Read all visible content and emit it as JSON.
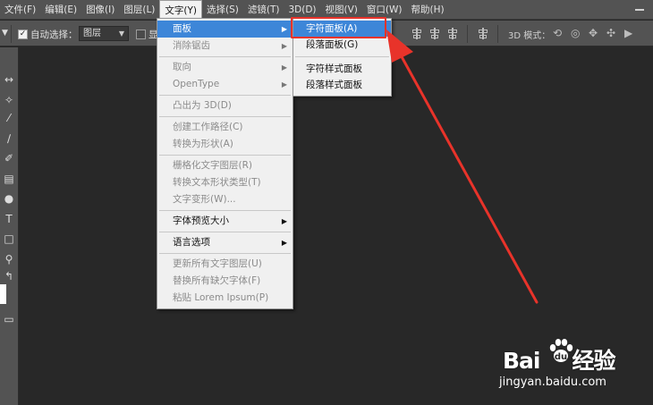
{
  "menubar": {
    "items": [
      "文件(F)",
      "编辑(E)",
      "图像(I)",
      "图层(L)",
      "文字(Y)",
      "选择(S)",
      "滤镜(T)",
      "3D(D)",
      "视图(V)",
      "窗口(W)",
      "帮助(H)"
    ],
    "active_index": 4
  },
  "options": {
    "auto_select_label": "自动选择：",
    "auto_select_value": "图层",
    "show_partial": "显",
    "mode_3d_label": "3D 模式："
  },
  "text_menu": {
    "items": [
      {
        "label": "面板",
        "submenu": true,
        "enabled": true,
        "highlighted": true
      },
      {
        "label": "消除锯齿",
        "submenu": true,
        "enabled": false
      },
      {
        "sep": true
      },
      {
        "label": "取向",
        "submenu": true,
        "enabled": false
      },
      {
        "label": "OpenType",
        "submenu": true,
        "enabled": false
      },
      {
        "sep": true
      },
      {
        "label": "凸出为 3D(D)",
        "enabled": false
      },
      {
        "sep": true
      },
      {
        "label": "创建工作路径(C)",
        "enabled": false
      },
      {
        "label": "转换为形状(A)",
        "enabled": false
      },
      {
        "sep": true
      },
      {
        "label": "栅格化文字图层(R)",
        "enabled": false
      },
      {
        "label": "转换文本形状类型(T)",
        "enabled": false
      },
      {
        "label": "文字变形(W)...",
        "enabled": false
      },
      {
        "sep": true
      },
      {
        "label": "字体预览大小",
        "submenu": true,
        "enabled": true
      },
      {
        "sep": true
      },
      {
        "label": "语言选项",
        "submenu": true,
        "enabled": true
      },
      {
        "sep": true
      },
      {
        "label": "更新所有文字图层(U)",
        "enabled": false
      },
      {
        "label": "替换所有缺欠字体(F)",
        "enabled": false
      },
      {
        "label": "粘贴 Lorem Ipsum(P)",
        "enabled": false
      }
    ]
  },
  "panel_submenu": {
    "items": [
      {
        "label": "字符面板(A)",
        "highlighted": true
      },
      {
        "label": "段落面板(G)"
      },
      {
        "sep": true
      },
      {
        "label": "字符样式面板"
      },
      {
        "label": "段落样式面板"
      }
    ]
  },
  "watermark": {
    "logo_left": "Bai",
    "logo_right": "经验",
    "url": "jingyan.baidu.com"
  },
  "colors": {
    "highlight": "#3d86d8",
    "annotation": "#e8332a",
    "chrome": "#535353",
    "canvas": "#282828"
  }
}
